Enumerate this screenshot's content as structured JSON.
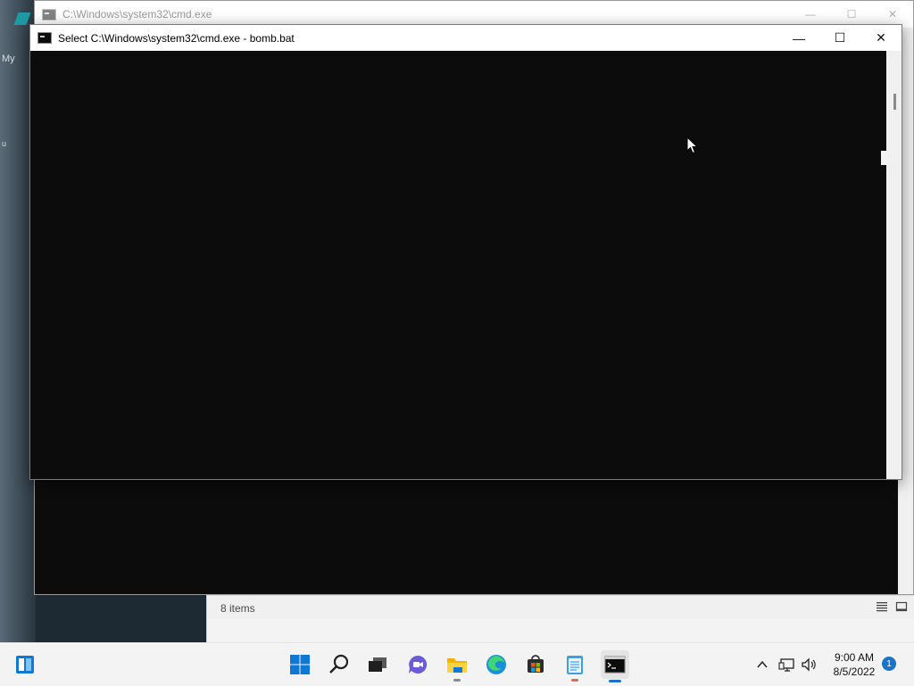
{
  "desktop": {
    "labels": [
      "My",
      "u"
    ]
  },
  "back_window": {
    "title": "C:\\Windows\\system32\\cmd.exe",
    "controls": {
      "minimize": "—",
      "maximize": "☐",
      "close": "✕"
    }
  },
  "front_window": {
    "title": "Select C:\\Windows\\system32\\cmd.exe - bomb.bat",
    "controls": {
      "minimize": "—",
      "maximize": "☐",
      "close": "✕"
    }
  },
  "explorer": {
    "status_items": "8 items"
  },
  "taskbar": {
    "apps": [
      {
        "icon": "start-icon"
      },
      {
        "icon": "search-icon"
      },
      {
        "icon": "task-view-icon"
      },
      {
        "icon": "chat-icon"
      },
      {
        "icon": "file-explorer-icon"
      },
      {
        "icon": "edge-icon"
      },
      {
        "icon": "store-icon"
      },
      {
        "icon": "notepad-icon"
      },
      {
        "icon": "cmd-icon"
      }
    ],
    "clock": {
      "time": "9:00 AM",
      "date": "8/5/2022"
    },
    "notification_count": "1",
    "colors": {
      "accent": "#1a73c8",
      "taskbar": "#f3f3f3"
    }
  }
}
